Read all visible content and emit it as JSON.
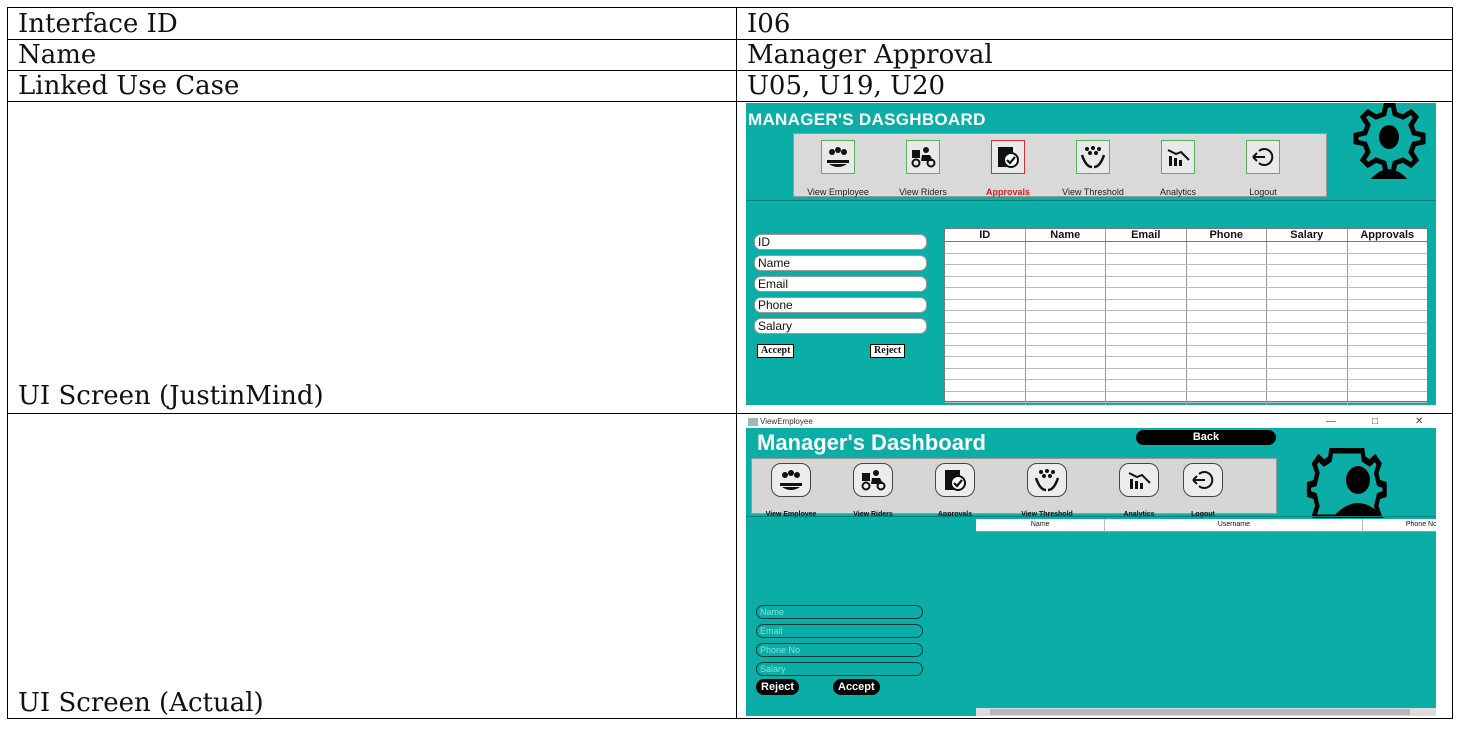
{
  "spec": {
    "rows": [
      {
        "label": "Interface ID",
        "value": "I06"
      },
      {
        "label": "Name",
        "value": "Manager Approval"
      },
      {
        "label": "Linked Use Case",
        "value": "U05, U19, U20"
      }
    ],
    "justinmind_label": "UI Screen (JustinMind)",
    "actual_label": "UI Screen (Actual)"
  },
  "mockup": {
    "title": "MANAGER'S DASGHBOARD",
    "nav": [
      {
        "label": "View Employee",
        "icon": "employees-icon"
      },
      {
        "label": "View Riders",
        "icon": "rider-scooter-icon"
      },
      {
        "label": "Approvals",
        "icon": "approvals-icon",
        "active": true
      },
      {
        "label": "View Threshold",
        "icon": "threshold-icon"
      },
      {
        "label": "Analytics",
        "icon": "analytics-icon"
      },
      {
        "label": "Logout",
        "icon": "logout-icon"
      }
    ],
    "fields": [
      "ID",
      "Name",
      "Email",
      "Phone",
      "Salary"
    ],
    "accept_label": "Accept",
    "reject_label": "Reject",
    "columns": [
      "ID",
      "Name",
      "Email",
      "Phone",
      "Salary",
      "Approvals"
    ]
  },
  "actual": {
    "window_title": "ViewEmployee",
    "title": "Manager's Dashboard",
    "back_label": "Back",
    "nav": [
      {
        "label": "View Employee",
        "icon": "employees-icon"
      },
      {
        "label": "View Riders",
        "icon": "rider-scooter-icon"
      },
      {
        "label": "Approvals",
        "icon": "approvals-icon"
      },
      {
        "label": "View Threshold",
        "icon": "threshold-icon"
      },
      {
        "label": "Analytics",
        "icon": "analytics-icon"
      },
      {
        "label": "Logout",
        "icon": "logout-icon"
      }
    ],
    "columns": [
      "Name",
      "Username",
      "Phone No"
    ],
    "placeholders": [
      "Name",
      "Email",
      "Phone No",
      "Salary"
    ],
    "reject_label": "Reject",
    "accept_label": "Accept"
  },
  "colors": {
    "teal": "#0aaea6",
    "black": "#000000",
    "active_red": "#d32020"
  }
}
